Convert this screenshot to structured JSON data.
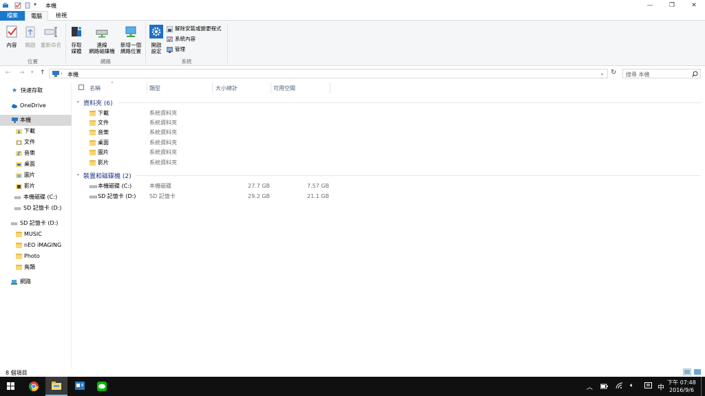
{
  "window": {
    "title": "本機"
  },
  "ribbon_tabs": [
    {
      "label": "檔案"
    },
    {
      "label": "電腦"
    },
    {
      "label": "檢視"
    }
  ],
  "ribbon": {
    "groups": {
      "location": "位置",
      "network": "網路",
      "system": "系統"
    },
    "buttons": {
      "properties": "內容",
      "open": "開啟",
      "rename": "重新命名",
      "access_media_1": "存取",
      "access_media_2": "媒體",
      "map_drive_1": "連線",
      "map_drive_2": "網路磁碟機",
      "add_location_1": "新增一個",
      "add_location_2": "網路位置",
      "open_settings_1": "開啟",
      "open_settings_2": "設定",
      "uninstall": "解除安裝或變更程式",
      "system_properties": "系統內容",
      "manage": "管理"
    }
  },
  "address": {
    "path": "本機",
    "search_placeholder": "搜尋 本機"
  },
  "nav": [
    {
      "label": "快速存取"
    },
    {
      "label": "OneDrive"
    },
    {
      "label": "本機"
    },
    {
      "label": "下載"
    },
    {
      "label": "文件"
    },
    {
      "label": "音樂"
    },
    {
      "label": "桌面"
    },
    {
      "label": "圖片"
    },
    {
      "label": "影片"
    },
    {
      "label": "本機磁碟 (C:)"
    },
    {
      "label": "SD 記憶卡 (D:)"
    },
    {
      "label": "SD 記憶卡 (D:)"
    },
    {
      "label": "MUSIC"
    },
    {
      "label": "nEO iMAGING"
    },
    {
      "label": "Photo"
    },
    {
      "label": "鳥類"
    },
    {
      "label": "網路"
    }
  ],
  "columns": {
    "name": "名稱",
    "type": "類型",
    "total": "大小總計",
    "free": "可用空間"
  },
  "groups": {
    "folders": "資料夾 (6)",
    "devices": "裝置和磁碟機 (2)"
  },
  "folders": [
    {
      "name": "下載",
      "type": "系統資料夾"
    },
    {
      "name": "文件",
      "type": "系統資料夾"
    },
    {
      "name": "音樂",
      "type": "系統資料夾"
    },
    {
      "name": "桌面",
      "type": "系統資料夾"
    },
    {
      "name": "圖片",
      "type": "系統資料夾"
    },
    {
      "name": "影片",
      "type": "系統資料夾"
    }
  ],
  "drives": [
    {
      "name": "本機磁碟 (C:)",
      "type": "本機磁碟",
      "total": "27.7 GB",
      "free": "7.57 GB"
    },
    {
      "name": "SD 記憶卡 (D:)",
      "type": "SD 記憶卡",
      "total": "29.2 GB",
      "free": "21.1 GB"
    }
  ],
  "status": {
    "count": "8 個項目"
  },
  "taskbar": {
    "ime": "中",
    "time": "下午 07:48",
    "date": "2016/9/6"
  },
  "colors": {
    "file_tab": "#1979ca",
    "nav_selected": "#d9d9d9",
    "group_header": "#1e3287"
  }
}
